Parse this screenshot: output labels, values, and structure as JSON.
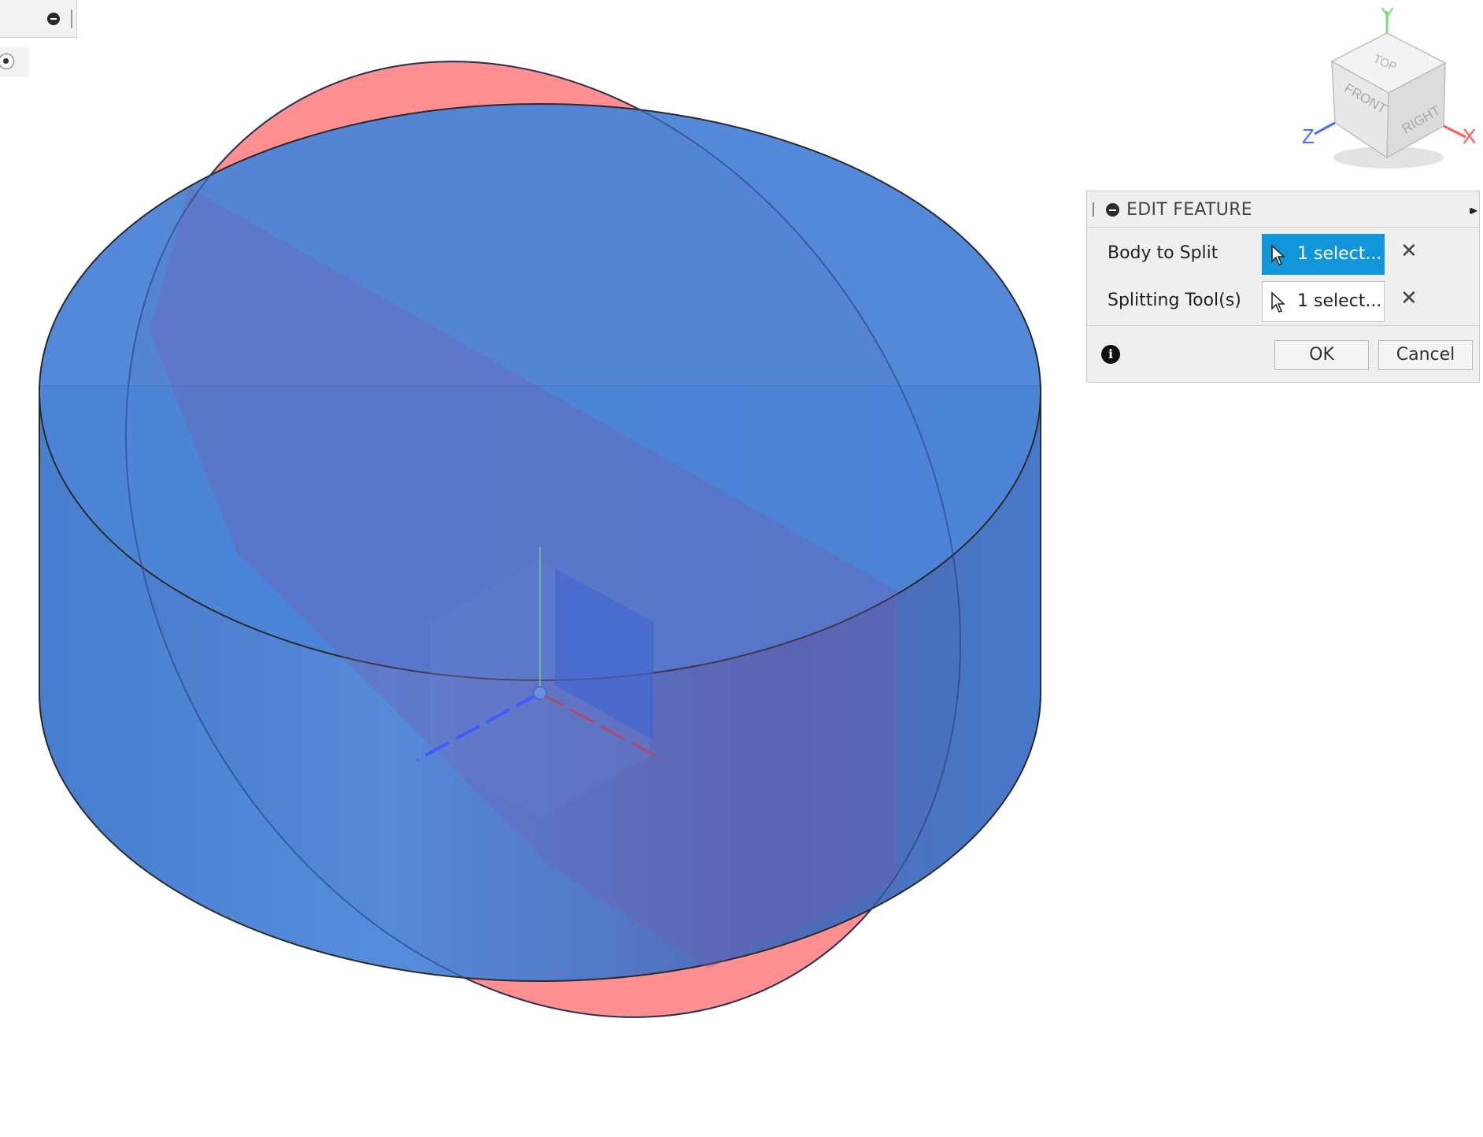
{
  "panel": {
    "title": "EDIT FEATURE",
    "rows": [
      {
        "label": "Body to Split",
        "selection": "1 select...",
        "active": true
      },
      {
        "label": "Splitting Tool(s)",
        "selection": "1 select...",
        "active": false
      }
    ],
    "clear_glyph": "✕",
    "info_glyph": "i",
    "ok_label": "OK",
    "cancel_label": "Cancel",
    "expand_glyph": "▸▸"
  },
  "viewcube": {
    "faces": {
      "top": "TOP",
      "front": "FRONT",
      "right": "RIGHT"
    },
    "axes": {
      "x": "X",
      "y": "Y",
      "z": "Z"
    }
  },
  "colors": {
    "body": "#4a7fd2",
    "plane": "#ff7a7a",
    "selection_active": "#1296db",
    "axis_x": "#ff5a5a",
    "axis_y": "#7cdc7c",
    "axis_z": "#4a6cff"
  }
}
